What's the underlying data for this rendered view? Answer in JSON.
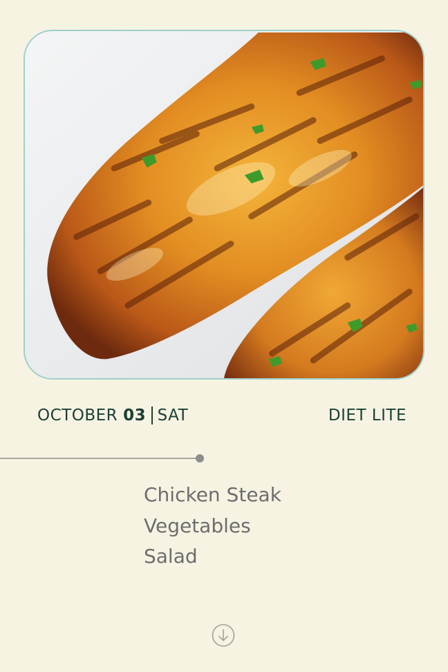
{
  "header": {
    "month": "OCTOBER",
    "day": "03",
    "weekday": "SAT",
    "plan": "DIET LITE"
  },
  "menu": {
    "items": [
      "Chicken Steak",
      "Vegetables",
      "Salad"
    ]
  },
  "icons": {
    "scroll": "arrow-down-circle-icon"
  },
  "colors": {
    "background": "#f6f3e3",
    "accent": "#1b4035",
    "frame_border": "#9fcfca",
    "menu_text": "#6d6d6d"
  }
}
